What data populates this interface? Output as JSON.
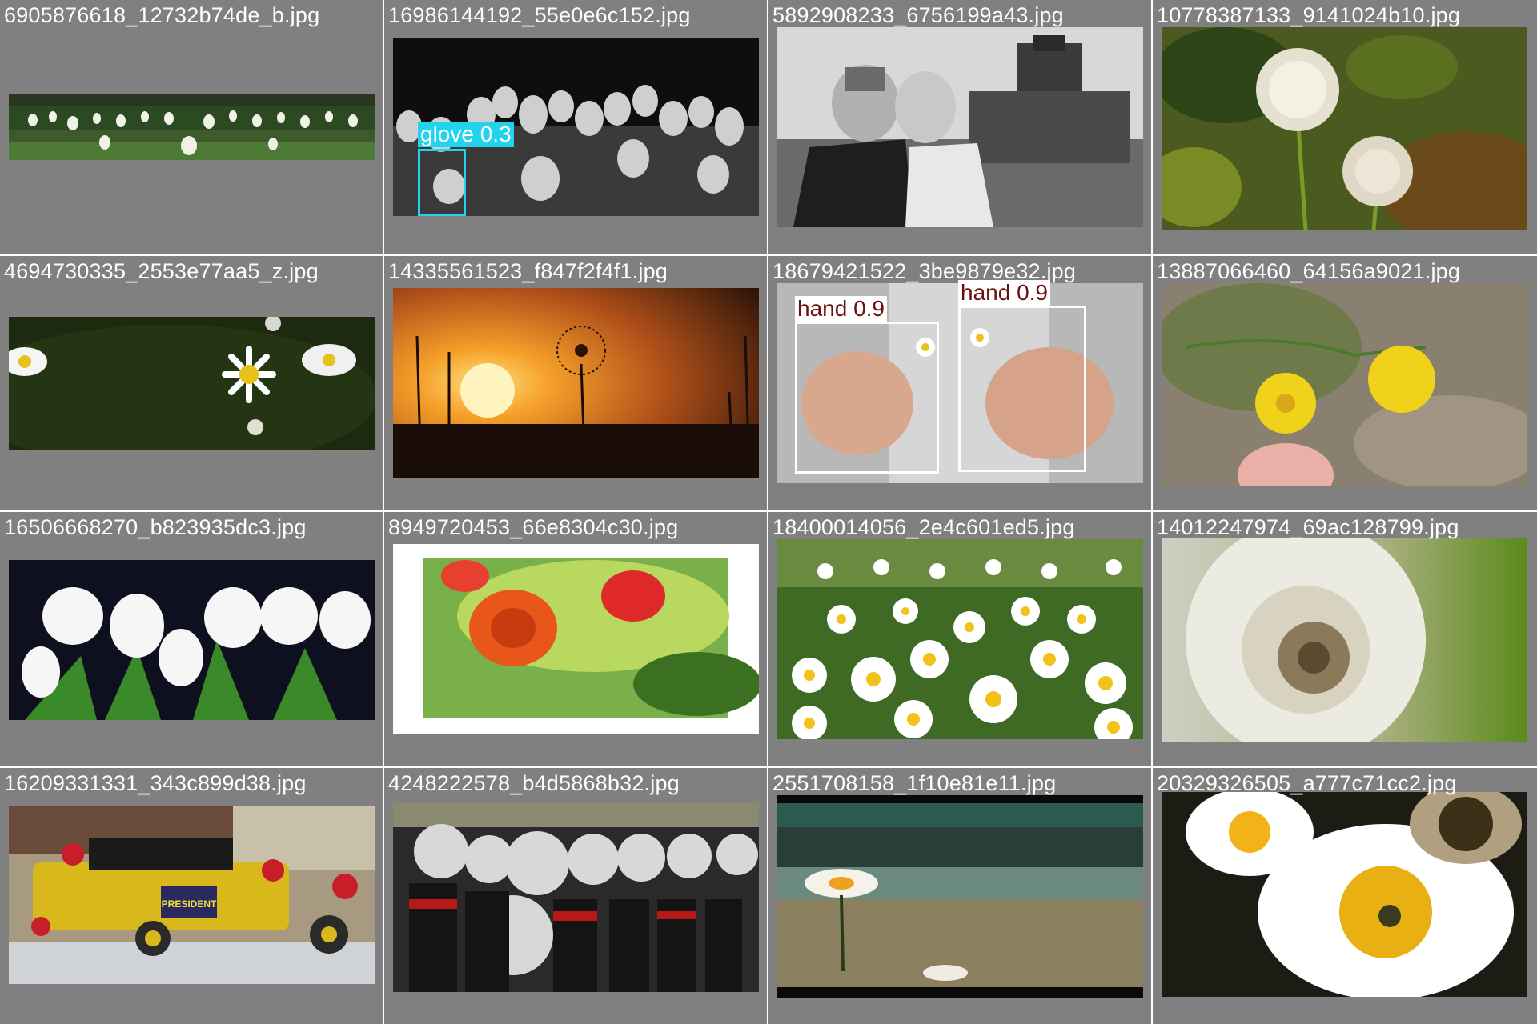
{
  "grid": {
    "cells": [
      {
        "filename": "6905876618_12732b74de_b.jpg",
        "scene": "tulip-field"
      },
      {
        "filename": "16986144192_55e0e6c152.jpg",
        "scene": "bw-tulips",
        "detections": [
          {
            "label": "glove 0.3",
            "class": "glove"
          }
        ]
      },
      {
        "filename": "5892908233_6756199a43.jpg",
        "scene": "bw-wedding"
      },
      {
        "filename": "10778387133_9141024b10.jpg",
        "scene": "dandelion-clocks"
      },
      {
        "filename": "4694730335_2553e77aa5_z.jpg",
        "scene": "daisies-dark"
      },
      {
        "filename": "14335561523_f847f2f4f1.jpg",
        "scene": "dandelion-sunset"
      },
      {
        "filename": "18679421522_3be9879e32.jpg",
        "scene": "hands-daisies",
        "detections": [
          {
            "label": "hand 0.9",
            "class": "hand"
          },
          {
            "label": "hand 0.9",
            "class": "hand"
          }
        ]
      },
      {
        "filename": "13887066460_64156a9021.jpg",
        "scene": "yellow-flowers"
      },
      {
        "filename": "16506668270_b823935dc3.jpg",
        "scene": "white-tulips"
      },
      {
        "filename": "8949720453_66e8304c30.jpg",
        "scene": "red-roses-framed"
      },
      {
        "filename": "18400014056_2e4c601ed5.jpg",
        "scene": "daisy-meadow"
      },
      {
        "filename": "14012247974_69ac128799.jpg",
        "scene": "dandelion-closeup"
      },
      {
        "filename": "16209331331_343c899d38.jpg",
        "scene": "parade-car"
      },
      {
        "filename": "4248222578_b4d5868b32.jpg",
        "scene": "marching-band"
      },
      {
        "filename": "2551708158_1f10e81e11.jpg",
        "scene": "beach-pier-flowers"
      },
      {
        "filename": "20329326505_a777c71cc2.jpg",
        "scene": "daisies-closeup"
      }
    ]
  },
  "embedded_text": {
    "parade_sign": "PRESIDENT"
  },
  "colors": {
    "cell_background": "#808080",
    "filename_text": "#ffffff",
    "glove_box": "#22d3ee",
    "hand_box": "#ffffff",
    "hand_label_text": "#6b0f0f"
  }
}
